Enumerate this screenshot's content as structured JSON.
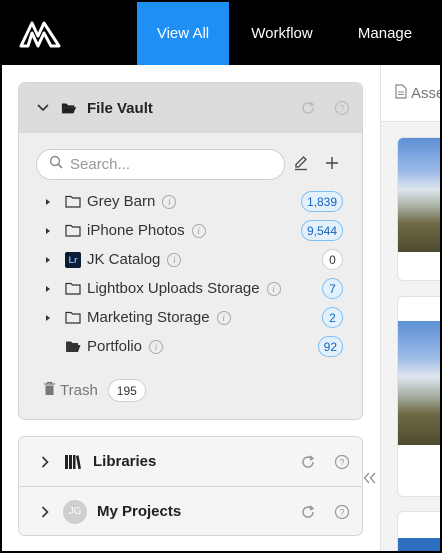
{
  "nav": {
    "tabs": [
      {
        "label": "View All"
      },
      {
        "label": "Workflow"
      },
      {
        "label": "Manage"
      }
    ],
    "active_color": "#1e90f5"
  },
  "vault": {
    "title": "File Vault",
    "search_placeholder": "Search...",
    "items": [
      {
        "label": "Grey Barn",
        "count": "1,839",
        "icon": "folder-icon",
        "expandable": true
      },
      {
        "label": "iPhone Photos",
        "count": "9,544",
        "icon": "folder-icon",
        "expandable": true
      },
      {
        "label": "JK Catalog",
        "count": "0",
        "icon": "lightroom-icon",
        "badge": "Lr",
        "expandable": true
      },
      {
        "label": "Lightbox Uploads Storage",
        "count": "7",
        "icon": "folder-icon",
        "expandable": true
      },
      {
        "label": "Marketing Storage",
        "count": "2",
        "icon": "folder-icon",
        "expandable": true
      },
      {
        "label": "Portfolio",
        "count": "92",
        "icon": "folder-open-icon",
        "expandable": false
      }
    ],
    "trash_label": "Trash",
    "trash_count": "195"
  },
  "libraries": {
    "title": "Libraries"
  },
  "projects": {
    "title": "My Projects",
    "avatar_initials": "JG"
  },
  "right_panel": {
    "tab_label": "Assets"
  }
}
